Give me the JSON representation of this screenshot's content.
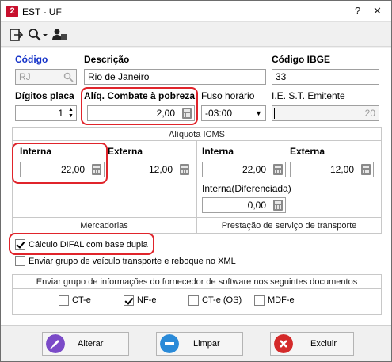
{
  "window": {
    "title": "EST - UF",
    "app_icon_letter": "2"
  },
  "toolbar": {
    "icons": [
      "exit-icon",
      "search-icon",
      "user-icon"
    ]
  },
  "fields": {
    "codigo_label": "Código",
    "codigo_value": "RJ",
    "descricao_label": "Descrição",
    "descricao_value": "Rio de Janeiro",
    "codigo_ibge_label": "Código IBGE",
    "codigo_ibge_value": "33",
    "digitos_placa_label": "Dígitos placa",
    "digitos_placa_value": "1",
    "aliq_combate_label": "Alíq. Combate à pobreza",
    "aliq_combate_value": "2,00",
    "fuso_label": "Fuso horário",
    "fuso_value": "-03:00",
    "iest_label": "I.E. S.T.  Emitente",
    "iest_value": "20"
  },
  "aliquota": {
    "group_title": "Alíquota ICMS",
    "mercadorias": {
      "caption": "Mercadorias",
      "interna_label": "Interna",
      "interna_value": "22,00",
      "externa_label": "Externa",
      "externa_value": "12,00"
    },
    "transporte": {
      "caption": "Prestação de serviço de transporte",
      "interna_label": "Interna",
      "interna_value": "22,00",
      "externa_label": "Externa",
      "externa_value": "12,00",
      "diferenciada_label": "Interna(Diferenciada)",
      "diferenciada_value": "0,00"
    }
  },
  "options": {
    "difal_label": "Cálculo DIFAL com base dupla",
    "difal_checked": true,
    "grupo_veiculo_label": "Enviar grupo de veículo transporte e reboque no XML",
    "grupo_veiculo_checked": false
  },
  "fornecedor": {
    "title": "Enviar grupo de informações do fornecedor de software nos seguintes documentos",
    "docs": [
      {
        "label": "CT-e",
        "checked": false
      },
      {
        "label": "NF-e",
        "checked": true
      },
      {
        "label": "CT-e (OS)",
        "checked": false
      },
      {
        "label": "MDF-e",
        "checked": false
      }
    ]
  },
  "buttons": {
    "alterar": "Alterar",
    "limpar": "Limpar",
    "excluir": "Excluir"
  },
  "colors": {
    "highlight": "#e0242b",
    "label_blue": "#1432c8",
    "alterar": "#7b4bc8",
    "limpar": "#2a8ad8",
    "excluir": "#d42a2a"
  }
}
